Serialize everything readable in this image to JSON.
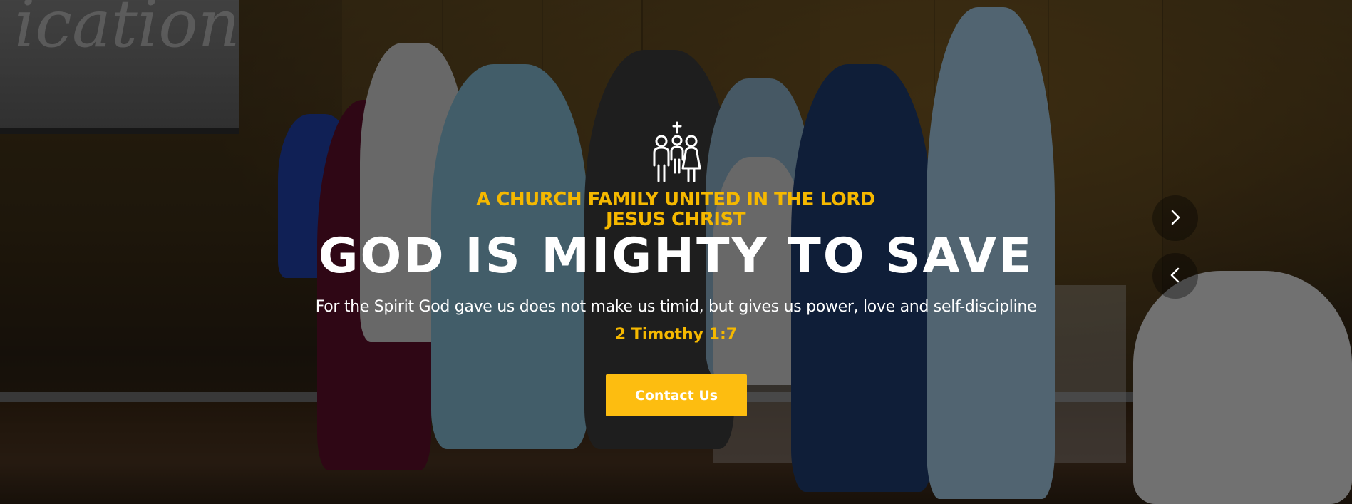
{
  "hero": {
    "background_text": "ication",
    "tagline": "A CHURCH FAMILY UNITED IN THE LORD JESUS CHRIST",
    "headline": "GOD IS MIGHTY TO SAVE",
    "verse": "For the Spirit God gave us does not make us timid, but gives us power, love and self-discipline",
    "reference": "2 Timothy 1:7",
    "cta_label": "Contact Us",
    "icons": {
      "logo": "family-cross-icon",
      "next": "chevron-right-icon",
      "prev": "chevron-left-icon"
    }
  },
  "colors": {
    "accent": "#f5b800",
    "button": "#fdbd10",
    "text": "#ffffff"
  }
}
